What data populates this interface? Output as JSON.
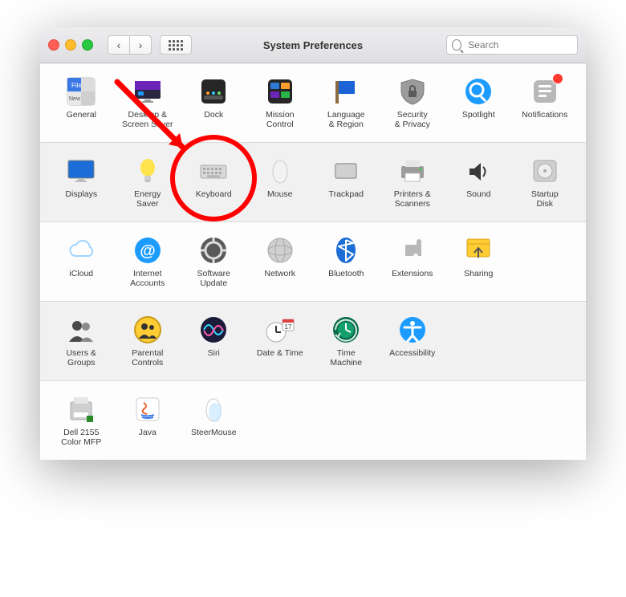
{
  "window": {
    "title": "System Preferences"
  },
  "search": {
    "placeholder": "Search",
    "value": ""
  },
  "rows": [
    {
      "bg": "light",
      "items": [
        {
          "id": "general",
          "label": "General"
        },
        {
          "id": "desktop",
          "label": "Desktop &\nScreen Saver"
        },
        {
          "id": "dock",
          "label": "Dock"
        },
        {
          "id": "mission-control",
          "label": "Mission\nControl"
        },
        {
          "id": "language-region",
          "label": "Language\n& Region"
        },
        {
          "id": "security-privacy",
          "label": "Security\n& Privacy"
        },
        {
          "id": "spotlight",
          "label": "Spotlight"
        },
        {
          "id": "notifications",
          "label": "Notifications",
          "badge": true
        }
      ]
    },
    {
      "bg": "dark",
      "items": [
        {
          "id": "displays",
          "label": "Displays"
        },
        {
          "id": "energy-saver",
          "label": "Energy\nSaver"
        },
        {
          "id": "keyboard",
          "label": "Keyboard",
          "highlighted": true
        },
        {
          "id": "mouse",
          "label": "Mouse"
        },
        {
          "id": "trackpad",
          "label": "Trackpad"
        },
        {
          "id": "printers-scanners",
          "label": "Printers &\nScanners"
        },
        {
          "id": "sound",
          "label": "Sound"
        },
        {
          "id": "startup-disk",
          "label": "Startup\nDisk"
        }
      ]
    },
    {
      "bg": "light",
      "items": [
        {
          "id": "icloud",
          "label": "iCloud"
        },
        {
          "id": "internet-accounts",
          "label": "Internet\nAccounts"
        },
        {
          "id": "software-update",
          "label": "Software\nUpdate"
        },
        {
          "id": "network",
          "label": "Network"
        },
        {
          "id": "bluetooth",
          "label": "Bluetooth"
        },
        {
          "id": "extensions",
          "label": "Extensions"
        },
        {
          "id": "sharing",
          "label": "Sharing"
        }
      ]
    },
    {
      "bg": "dark",
      "items": [
        {
          "id": "users-groups",
          "label": "Users &\nGroups"
        },
        {
          "id": "parental-controls",
          "label": "Parental\nControls"
        },
        {
          "id": "siri",
          "label": "Siri"
        },
        {
          "id": "date-time",
          "label": "Date & Time"
        },
        {
          "id": "time-machine",
          "label": "Time\nMachine"
        },
        {
          "id": "accessibility",
          "label": "Accessibility"
        }
      ]
    },
    {
      "bg": "light",
      "items": [
        {
          "id": "dell-2155",
          "label": "Dell 2155\nColor MFP"
        },
        {
          "id": "java",
          "label": "Java"
        },
        {
          "id": "steermouse",
          "label": "SteerMouse"
        }
      ]
    }
  ],
  "annotation": {
    "target_id": "keyboard",
    "type": "circle-with-arrow"
  }
}
